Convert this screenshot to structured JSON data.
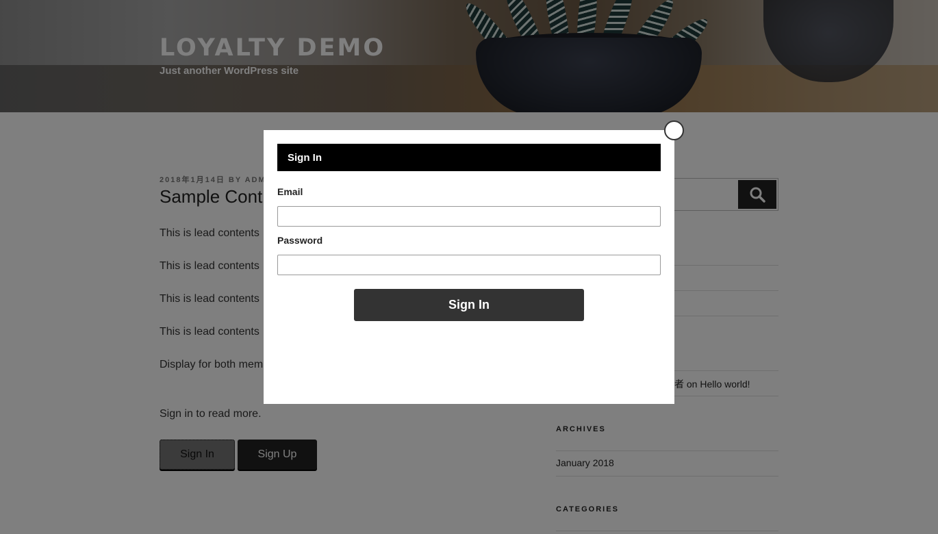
{
  "header": {
    "site_title": "LOYALTY DEMO",
    "tagline": "Just another WordPress site"
  },
  "post": {
    "meta": "2018年1月14日 BY ADM",
    "title": "Sample Cont",
    "paragraphs": [
      "This is lead contents",
      "This is lead contents",
      "This is lead contents",
      "This is lead contents",
      "Display for both mem"
    ],
    "sign_in_prompt": "Sign in to read more.",
    "signin_button": "Sign In",
    "signup_button": "Sign Up"
  },
  "sidebar": {
    "search_icon": "search-icon",
    "recent_comment": "者 on Hello world!",
    "archives_title": "ARCHIVES",
    "archives_link": "January 2018",
    "categories_title": "CATEGORIES"
  },
  "modal": {
    "title": "Sign In",
    "email_label": "Email",
    "email_value": "",
    "password_label": "Password",
    "password_value": "",
    "submit_label": "Sign In",
    "close_icon": "close-icon"
  }
}
